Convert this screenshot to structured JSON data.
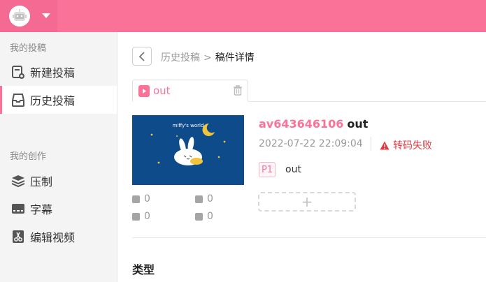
{
  "header": {
    "brand_color": "#fb7299"
  },
  "sidebar": {
    "section1_title": "我的投稿",
    "items1": [
      {
        "label": "新建投稿",
        "icon": "new-upload-icon"
      },
      {
        "label": "历史投稿",
        "icon": "history-uploads-icon",
        "active": true
      }
    ],
    "section2_title": "我的创作",
    "items2": [
      {
        "label": "压制",
        "icon": "layers-icon"
      },
      {
        "label": "字幕",
        "icon": "subtitle-icon"
      },
      {
        "label": "编辑视频",
        "icon": "scissors-icon"
      }
    ]
  },
  "breadcrumb": {
    "parent": "历史投稿",
    "separator": ">",
    "current": "稿件详情"
  },
  "tab": {
    "label": "out"
  },
  "video": {
    "thumbnail_caption": "miffy's world",
    "av_id": "av643646106",
    "title": "out",
    "datetime": "2022-07-22 22:09:04",
    "status": "转码失败",
    "stats": {
      "plays": "0",
      "danmaku": "0",
      "coins": "0",
      "comments": "0"
    },
    "parts": [
      {
        "badge": "P1",
        "title": "out"
      }
    ],
    "add_part_label": "+"
  },
  "section": {
    "type_title": "类型"
  },
  "colors": {
    "accent": "#fb7299",
    "error": "#e0393e",
    "muted": "#999999"
  }
}
